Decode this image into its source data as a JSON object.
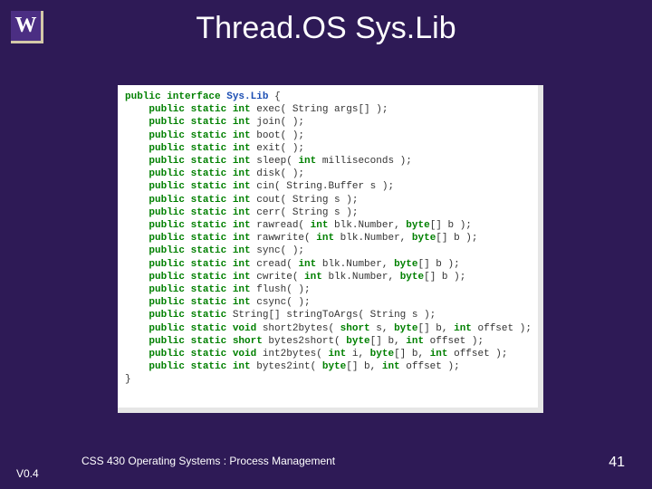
{
  "logo": {
    "letter": "W"
  },
  "title": "Thread.OS Sys.Lib",
  "footer": {
    "version": "V0.4",
    "course": "CSS 430 Operating Systems : Process Management",
    "page": "41"
  },
  "code": {
    "decl_open": "public interface",
    "class_name": "Sys.Lib",
    "brace_open": "{",
    "brace_close": "}",
    "lines": [
      {
        "mods": "public static int",
        "sig": " exec( String args[] );"
      },
      {
        "mods": "public static int",
        "sig": " join( );"
      },
      {
        "mods": "public static int",
        "sig": " boot( );"
      },
      {
        "mods": "public static int",
        "sig": " exit( );"
      },
      {
        "mods": "public static int",
        "sig_a": " sleep( ",
        "kw2": "int",
        "sig_b": " milliseconds );"
      },
      {
        "mods": "public static int",
        "sig": " disk( );"
      },
      {
        "mods": "public static int",
        "sig": " cin( String.Buffer s );"
      },
      {
        "mods": "public static int",
        "sig": " cout( String s );"
      },
      {
        "mods": "public static int",
        "sig": " cerr( String s );"
      },
      {
        "mods": "public static int",
        "sig_a": " rawread( ",
        "kw2": "int",
        "sig_b": " blk.Number, ",
        "kw3": "byte",
        "sig_c": "[] b );"
      },
      {
        "mods": "public static int",
        "sig_a": " rawwrite( ",
        "kw2": "int",
        "sig_b": " blk.Number, ",
        "kw3": "byte",
        "sig_c": "[] b );"
      },
      {
        "mods": "public static int",
        "sig": " sync( );"
      },
      {
        "mods": "public static int",
        "sig_a": " cread( ",
        "kw2": "int",
        "sig_b": " blk.Number, ",
        "kw3": "byte",
        "sig_c": "[] b );"
      },
      {
        "mods": "public static int",
        "sig_a": " cwrite( ",
        "kw2": "int",
        "sig_b": " blk.Number, ",
        "kw3": "byte",
        "sig_c": "[] b );"
      },
      {
        "mods": "public static int",
        "sig": " flush( );"
      },
      {
        "mods": "public static int",
        "sig": " csync( );"
      },
      {
        "mods": "public static",
        "sig": " String[] stringToArgs( String s );"
      },
      {
        "mods": "public static void",
        "sig_a": " short2bytes( ",
        "kw2": "short",
        "sig_b": " s, ",
        "kw3": "byte",
        "sig_c": "[] b, ",
        "kw4": "int",
        "sig_d": " offset );"
      },
      {
        "mods": "public static short",
        "sig_a": " bytes2short( ",
        "kw2": "byte",
        "sig_b": "[] b, ",
        "kw3": "int",
        "sig_c": " offset );"
      },
      {
        "mods": "public static void",
        "sig_a": " int2bytes( ",
        "kw2": "int",
        "sig_b": " i, ",
        "kw3": "byte",
        "sig_c": "[] b, ",
        "kw4": "int",
        "sig_d": " offset );"
      },
      {
        "mods": "public static int",
        "sig_a": " bytes2int( ",
        "kw2": "byte",
        "sig_b": "[] b, ",
        "kw3": "int",
        "sig_c": " offset );"
      }
    ]
  }
}
